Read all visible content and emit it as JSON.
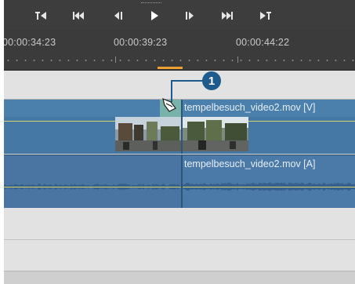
{
  "transport": {
    "buttons": [
      {
        "name": "go-to-in-icon"
      },
      {
        "name": "previous-edit-icon"
      },
      {
        "name": "step-back-icon"
      },
      {
        "name": "play-icon"
      },
      {
        "name": "step-forward-icon"
      },
      {
        "name": "next-edit-icon"
      },
      {
        "name": "go-to-out-icon"
      }
    ]
  },
  "ruler": {
    "timecodes": [
      "00:00:34:23",
      "00:00:39:23",
      "00:00:44:22"
    ]
  },
  "tracks": {
    "video_clip_title": "tempelbesuch_video2.mov [V]",
    "audio_clip_title": "tempelbesuch_video2.mov [A]"
  },
  "callout": {
    "number": "1"
  },
  "colors": {
    "video_clip": "#4b7fac",
    "audio_clip": "#4b7aa9",
    "transition": "#78b2a8",
    "keyframe_line": "#d8d36a",
    "work_area_marker": "#f0a030",
    "callout": "#1e5a8c"
  }
}
